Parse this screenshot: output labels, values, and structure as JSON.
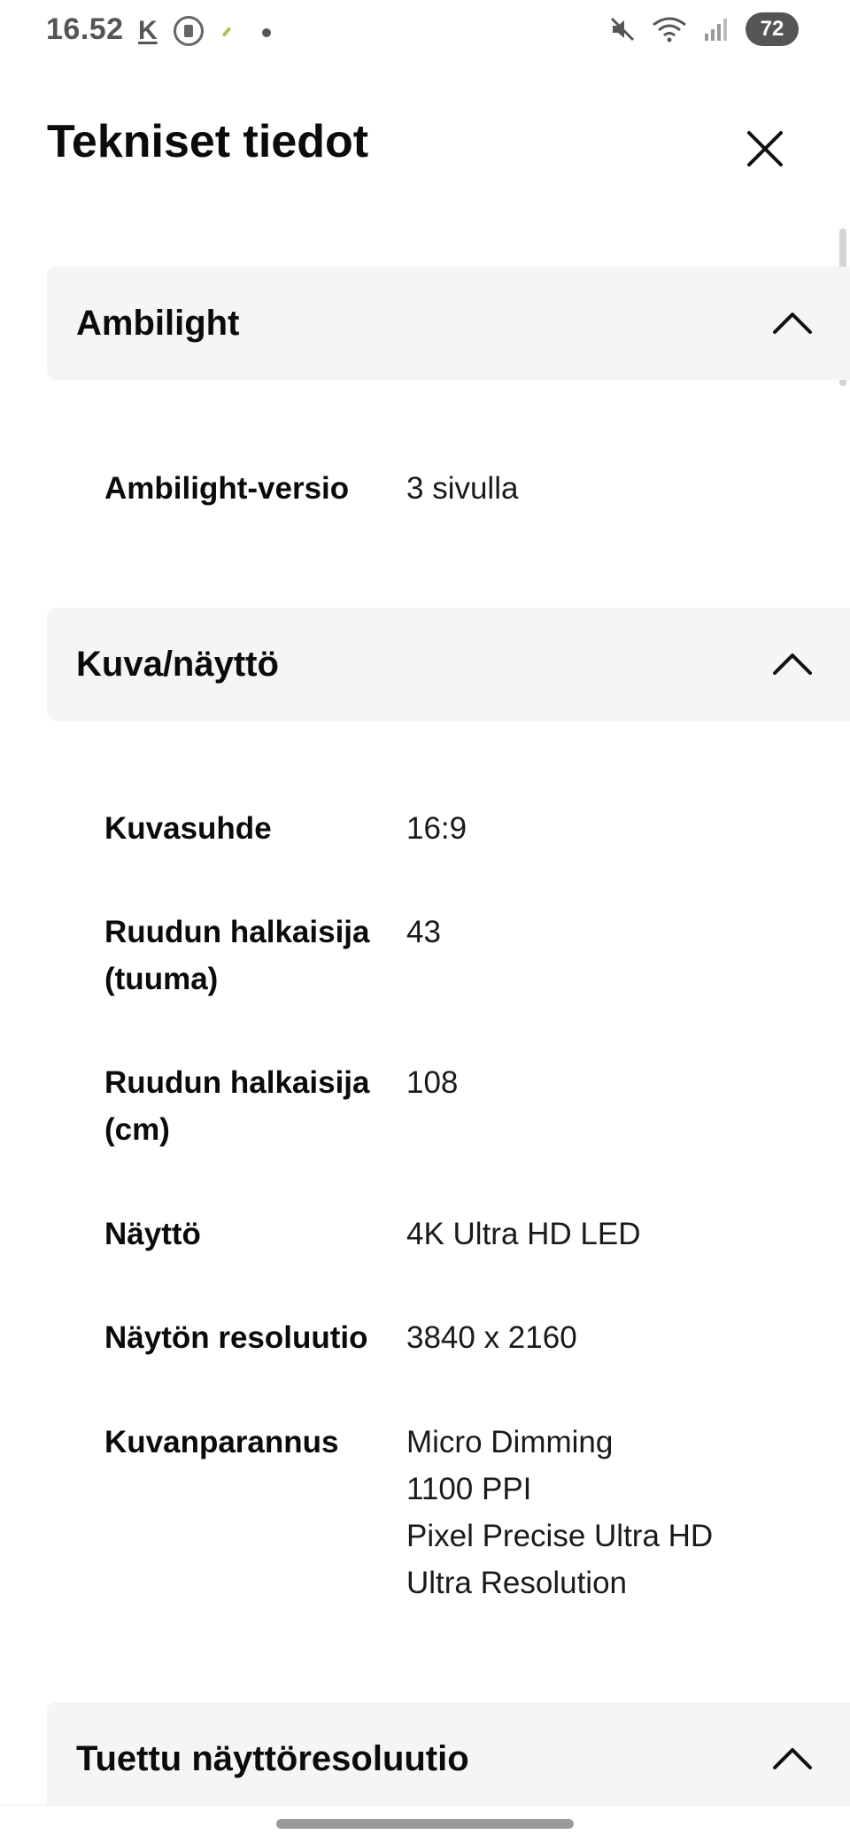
{
  "status_bar": {
    "time": "16.52",
    "k_label": "K",
    "battery": "72",
    "icons": [
      "k-app-icon",
      "clipboard-icon",
      "leaf-icon",
      "dot-icon",
      "mute-icon",
      "wifi-icon",
      "signal-icon"
    ]
  },
  "header": {
    "title": "Tekniset tiedot",
    "close_icon": "close-icon"
  },
  "sections": [
    {
      "title": "Ambilight",
      "expanded": true,
      "specs": [
        {
          "label": "Ambilight-versio",
          "value": [
            "3 sivulla"
          ]
        }
      ]
    },
    {
      "title": "Kuva/näyttö",
      "expanded": true,
      "specs": [
        {
          "label": "Kuvasuhde",
          "value": [
            "16:9"
          ]
        },
        {
          "label": "Ruudun halkaisija (tuuma)",
          "value": [
            "43"
          ]
        },
        {
          "label": "Ruudun halkaisija (cm)",
          "value": [
            "108"
          ]
        },
        {
          "label": "Näyttö",
          "value": [
            "4K Ultra HD LED"
          ]
        },
        {
          "label": "Näytön resoluutio",
          "value": [
            "3840 x 2160"
          ]
        },
        {
          "label": "Kuvanparannus",
          "value": [
            "Micro Dimming",
            "1100 PPI",
            "Pixel Precise Ultra HD",
            "Ultra Resolution"
          ]
        }
      ]
    },
    {
      "title": "Tuettu näyttöresoluutio",
      "expanded": true,
      "specs": []
    }
  ],
  "colors": {
    "section_bg": "#f4f5f6",
    "text": "#0b0b0b",
    "status_gray": "#555555"
  }
}
